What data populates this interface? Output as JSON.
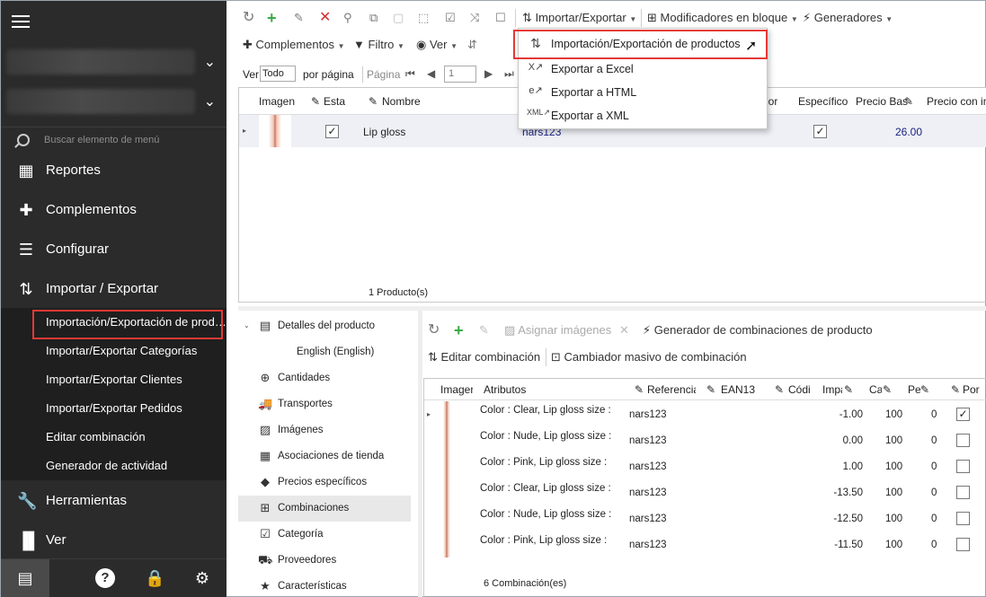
{
  "sidebar": {
    "search_placeholder": "Buscar elemento de menú",
    "nav": [
      {
        "label": "Reportes",
        "icon": "reports-icon"
      },
      {
        "label": "Complementos",
        "icon": "puzzle-icon"
      },
      {
        "label": "Configurar",
        "icon": "sliders-icon"
      },
      {
        "label": "Importar / Exportar",
        "icon": "import-export-icon"
      }
    ],
    "sub": [
      {
        "label": "Importación/Exportación de prod…"
      },
      {
        "label": "Importar/Exportar Categorías"
      },
      {
        "label": "Importar/Exportar Clientes"
      },
      {
        "label": "Importar/Exportar Pedidos"
      },
      {
        "label": "Editar combinación"
      },
      {
        "label": "Generador de actividad"
      }
    ],
    "nav2": [
      {
        "label": "Herramientas",
        "icon": "wrench-icon"
      },
      {
        "label": "Ver",
        "icon": "view-icon"
      }
    ]
  },
  "toolbar1": {
    "import_export": "Importar/Exportar",
    "bulk_modifiers": "Modificadores en bloque",
    "generators": "Generadores"
  },
  "toolbar2": {
    "addons": "Complementos",
    "filter": "Filtro",
    "view": "Ver"
  },
  "pager": {
    "ver": "Ver",
    "per_page_value": "Todo",
    "per_page": "por página",
    "page_label": "Página",
    "page_value": "1"
  },
  "dropdown": {
    "items": [
      {
        "label": "Importación/Exportación de productos",
        "icon": "import-export-icon"
      },
      {
        "label": "Exportar a Excel",
        "icon": "excel-icon"
      },
      {
        "label": "Exportar a HTML",
        "icon": "html-icon"
      },
      {
        "label": "Exportar a XML",
        "icon": "xml-icon"
      }
    ]
  },
  "grid_top": {
    "headers": {
      "image": "Imagen",
      "status": "Esta",
      "name": "Nombre",
      "color": "lor",
      "specific": "Específico",
      "base_price": "Precio Bas",
      "price_with": "Precio con im"
    },
    "row": {
      "name": "Lip gloss",
      "reference": "nars123",
      "price": "26.00"
    },
    "footer": "1 Producto(s)"
  },
  "tree": {
    "items": [
      {
        "label": "Detalles del producto",
        "icon": "details-icon"
      },
      {
        "label": "English (English)",
        "icon": ""
      },
      {
        "label": "Cantidades",
        "icon": "quantity-icon"
      },
      {
        "label": "Transportes",
        "icon": "truck-icon"
      },
      {
        "label": "Imágenes",
        "icon": "image-icon"
      },
      {
        "label": "Asociaciones de tienda",
        "icon": "store-icon"
      },
      {
        "label": "Precios específicos",
        "icon": "tag-icon"
      },
      {
        "label": "Combinaciones",
        "icon": "grid-icon"
      },
      {
        "label": "Categoría",
        "icon": "category-icon"
      },
      {
        "label": "Proveedores",
        "icon": "supplier-icon"
      },
      {
        "label": "Características",
        "icon": "star-icon"
      }
    ]
  },
  "comb_toolbar": {
    "assign_images": "Asignar imágenes",
    "generator": "Generador de combinaciones de producto",
    "edit": "Editar combinación",
    "bulk_changer": "Cambiador masivo de combinación"
  },
  "grid_bot": {
    "headers": {
      "image": "Imager",
      "attributes": "Atributos",
      "reference": "Referencia",
      "ean": "EAN13",
      "code": "Códi",
      "impact": "Impa",
      "ca": "Ca",
      "pe": "Pe",
      "por": "Por"
    },
    "rows": [
      {
        "attr1": "Color : Clear, Lip gloss size :",
        "ref": "nars123",
        "imp": "-1.00",
        "ca": "100",
        "pe": "0",
        "checked": true
      },
      {
        "attr1": "Color : Nude, Lip gloss size :",
        "ref": "nars123",
        "imp": "0.00",
        "ca": "100",
        "pe": "0",
        "checked": false
      },
      {
        "attr1": "Color : Pink, Lip gloss size :",
        "ref": "nars123",
        "imp": "1.00",
        "ca": "100",
        "pe": "0",
        "checked": false
      },
      {
        "attr1": "Color : Clear, Lip gloss size :",
        "ref": "nars123",
        "imp": "-13.50",
        "ca": "100",
        "pe": "0",
        "checked": false
      },
      {
        "attr1": "Color : Nude, Lip gloss size :",
        "ref": "nars123",
        "imp": "-12.50",
        "ca": "100",
        "pe": "0",
        "checked": false
      },
      {
        "attr1": "Color : Pink, Lip gloss size :",
        "ref": "nars123",
        "imp": "-11.50",
        "ca": "100",
        "pe": "0",
        "checked": false
      }
    ],
    "footer": "6 Combinación(es)"
  }
}
